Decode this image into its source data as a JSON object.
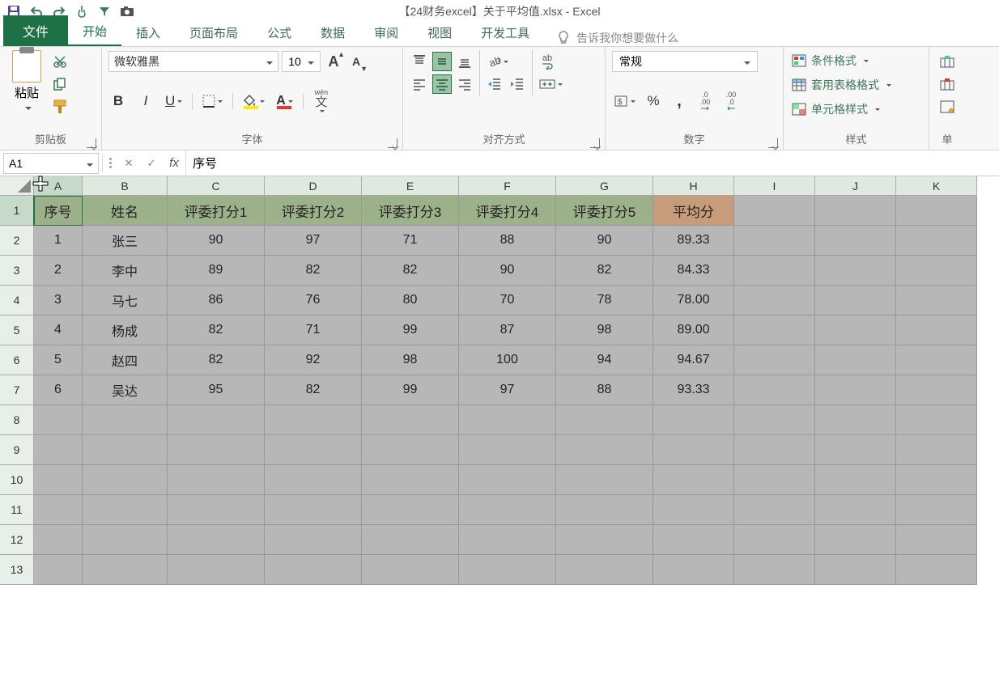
{
  "title": "【24财务excel】关于平均值.xlsx  -  Excel",
  "qat_icons": [
    "save",
    "undo",
    "redo",
    "touch",
    "filter",
    "camera"
  ],
  "tabs": {
    "file": "文件",
    "list": [
      "开始",
      "插入",
      "页面布局",
      "公式",
      "数据",
      "审阅",
      "视图",
      "开发工具"
    ],
    "active_index": 0,
    "tell_me": "告诉我你想要做什么"
  },
  "ribbon": {
    "clipboard": {
      "label": "剪贴板",
      "paste": "粘贴"
    },
    "font": {
      "label": "字体",
      "name": "微软雅黑",
      "size": "10",
      "wen": "wén",
      "wen2": "文"
    },
    "alignment": {
      "label": "对齐方式",
      "wrap": "ab"
    },
    "number": {
      "label": "数字",
      "format": "常规",
      "inc": ".0",
      "dec": ".00",
      "inc2": ".00",
      "dec2": ".0"
    },
    "styles": {
      "label": "样式",
      "cond": "条件格式",
      "table": "套用表格格式",
      "cell": "单元格样式"
    },
    "cells": {
      "label": "单"
    }
  },
  "namebox": "A1",
  "formula_value": "序号",
  "grid": {
    "col_letters": [
      "A",
      "B",
      "C",
      "D",
      "E",
      "F",
      "G",
      "H",
      "I",
      "J",
      "K"
    ],
    "headers": [
      "序号",
      "姓名",
      "评委打分1",
      "评委打分2",
      "评委打分3",
      "评委打分4",
      "评委打分5",
      "平均分"
    ],
    "rows": [
      [
        "1",
        "张三",
        "90",
        "97",
        "71",
        "88",
        "90",
        "89.33"
      ],
      [
        "2",
        "李中",
        "89",
        "82",
        "82",
        "90",
        "82",
        "84.33"
      ],
      [
        "3",
        "马七",
        "86",
        "76",
        "80",
        "70",
        "78",
        "78.00"
      ],
      [
        "4",
        "杨成",
        "82",
        "71",
        "99",
        "87",
        "98",
        "89.00"
      ],
      [
        "5",
        "赵四",
        "82",
        "92",
        "98",
        "100",
        "94",
        "94.67"
      ],
      [
        "6",
        "吴达",
        "95",
        "82",
        "99",
        "97",
        "88",
        "93.33"
      ]
    ],
    "empty_rows": 6
  }
}
